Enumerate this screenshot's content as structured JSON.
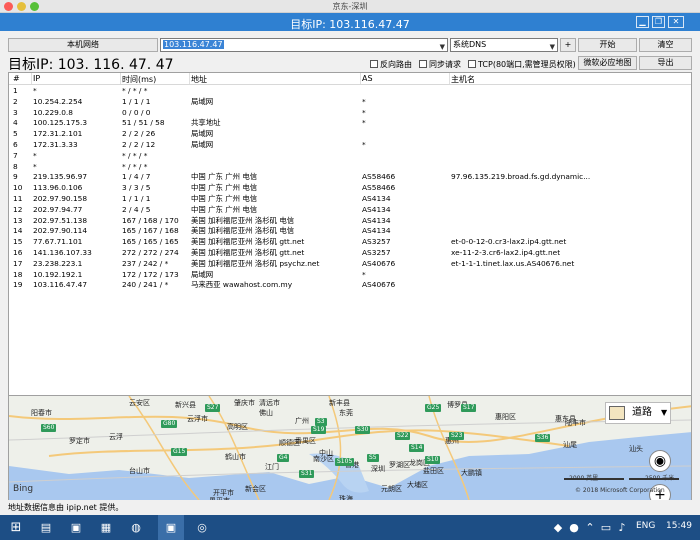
{
  "mac_title": "京东-深圳",
  "window_title": "目标IP: 103.116.47.47",
  "toolbar": {
    "local_network_label": "本机网络",
    "target_value": "103.116.47.47",
    "dns_value": "系统DNS",
    "plus_label": "+",
    "start_label": "开始",
    "clear_label": "清空",
    "big_target": "目标IP:  103. 116. 47. 47",
    "reverse_route_label": "反向路由",
    "sync_request_label": "同步请求",
    "tcp_label": "TCP(80端口,需管理员权限)",
    "accurate_map_label": "微软必应地图",
    "export_label": "导出"
  },
  "table": {
    "headers": [
      "#",
      "IP",
      "时间(ms)",
      "地址",
      "AS",
      "主机名"
    ],
    "rows": [
      [
        "1",
        "*",
        "* / * / *",
        "",
        "",
        ""
      ],
      [
        "2",
        "10.254.2.254",
        "1 / 1 / 1",
        "局域网",
        "*",
        ""
      ],
      [
        "3",
        "10.229.0.8",
        "0 / 0 / 0",
        "",
        "*",
        ""
      ],
      [
        "4",
        "100.125.175.3",
        "51 / 51 / 58",
        "共享地址",
        "*",
        ""
      ],
      [
        "5",
        "172.31.2.101",
        "2 / 2 / 26",
        "局域网",
        "",
        ""
      ],
      [
        "6",
        "172.31.3.33",
        "2 / 2 / 12",
        "局域网",
        "*",
        ""
      ],
      [
        "7",
        "*",
        "* / * / *",
        "",
        "",
        ""
      ],
      [
        "8",
        "*",
        "* / * / *",
        "",
        "",
        ""
      ],
      [
        "9",
        "219.135.96.97",
        "1 / 4 / 7",
        "中国 广东 广州 电信",
        "AS58466",
        "97.96.135.219.broad.fs.gd.dynamic..."
      ],
      [
        "10",
        "113.96.0.106",
        "3 / 3 / 5",
        "中国 广东 广州 电信",
        "AS58466",
        ""
      ],
      [
        "11",
        "202.97.90.158",
        "1 / 1 / 1",
        "中国 广东 广州 电信",
        "AS4134",
        ""
      ],
      [
        "12",
        "202.97.94.77",
        "2 / 4 / 5",
        "中国 广东 广州 电信",
        "AS4134",
        ""
      ],
      [
        "13",
        "202.97.51.138",
        "167 / 168 / 170",
        "美国 加利福尼亚州 洛杉矶 电信",
        "AS4134",
        ""
      ],
      [
        "14",
        "202.97.90.114",
        "165 / 167 / 168",
        "美国 加利福尼亚州 洛杉矶 电信",
        "AS4134",
        ""
      ],
      [
        "15",
        "77.67.71.101",
        "165 / 165 / 165",
        "美国 加利福尼亚州 洛杉矶 gtt.net",
        "AS3257",
        "et-0-0-12-0.cr3-lax2.ip4.gtt.net"
      ],
      [
        "16",
        "141.136.107.33",
        "272 / 272 / 274",
        "美国 加利福尼亚州 洛杉矶 gtt.net",
        "AS3257",
        "xe-11-2-3.cr6-lax2.ip4.gtt.net"
      ],
      [
        "17",
        "23.238.223.1",
        "237 / 242 / *",
        "美国 加利福尼亚州 洛杉矶 psychz.net",
        "AS40676",
        "et-1-1-1.tinet.lax.us.AS40676.net"
      ],
      [
        "18",
        "10.192.192.1",
        "172 / 172 / 173",
        "局域网",
        "*",
        ""
      ],
      [
        "19",
        "103.116.47.47",
        "240 / 241 / *",
        "马来西亚 wawahost.com.my",
        "AS40676",
        ""
      ]
    ]
  },
  "map": {
    "labels": [
      "云安区",
      "阳春市",
      "罗定市",
      "云浮",
      "高明区",
      "佛山",
      "肇庆市",
      "东莞",
      "惠州",
      "惠阳区",
      "惠东县",
      "陆丰市",
      "汕尾",
      "新兴县",
      "顺德区",
      "中山",
      "深圳",
      "香港",
      "汕头",
      "开平市",
      "江门",
      "新会区",
      "鹤山市",
      "台山市",
      "恩平市",
      "珠海",
      "博罗县",
      "罗湖区",
      "大鹏镇",
      "龙岗区",
      "番禺区",
      "南沙区",
      "盐田区",
      "元朗区",
      "大埔区",
      "云浮市",
      "新丰县",
      "广州",
      "清远市"
    ],
    "shields": [
      "S60",
      "G80",
      "G15",
      "G25",
      "S17",
      "S27",
      "S22",
      "S23",
      "S3",
      "S5",
      "G4",
      "S31",
      "S10",
      "S105",
      "S14",
      "S19",
      "S30",
      "S36"
    ],
    "style_label": "道路",
    "scale_miles": "2000 英里",
    "scale_km": "2500 千米",
    "copyright": "© 2018 Microsoft Corporation",
    "bing": "Bing"
  },
  "status_text": "地址数据信息由 ipip.net 提供。",
  "taskbar": {
    "lang": "ENG",
    "time": "15:49"
  },
  "colors": {
    "titlebar": "#2f80d1",
    "taskbar": "#1d4e85",
    "selection": "#3b84d6"
  }
}
